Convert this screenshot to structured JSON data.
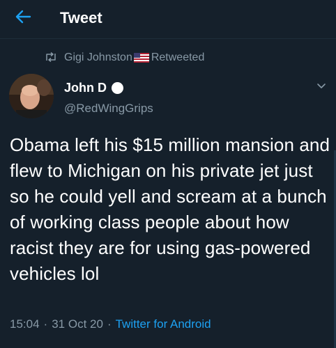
{
  "header": {
    "title": "Tweet",
    "back_icon": "back-arrow-icon",
    "accent_color": "#1da1f2"
  },
  "retweet": {
    "user": "Gigi Johnston",
    "flag_icon": "us-flag-icon",
    "action": "Retweeted"
  },
  "author": {
    "name": "John D",
    "handle": "@RedWingGrips"
  },
  "tweet": {
    "text": "Obama left his $15 million mansion and flew to Michigan on his private jet just so he could yell and scream at a bunch of working class people about how racist they are for using gas-powered vehicles lol",
    "time": "15:04",
    "date": "31 Oct 20",
    "source": "Twitter for Android"
  },
  "colors": {
    "background": "#15202b",
    "secondary_text": "#8899a6",
    "link": "#1da1f2"
  }
}
